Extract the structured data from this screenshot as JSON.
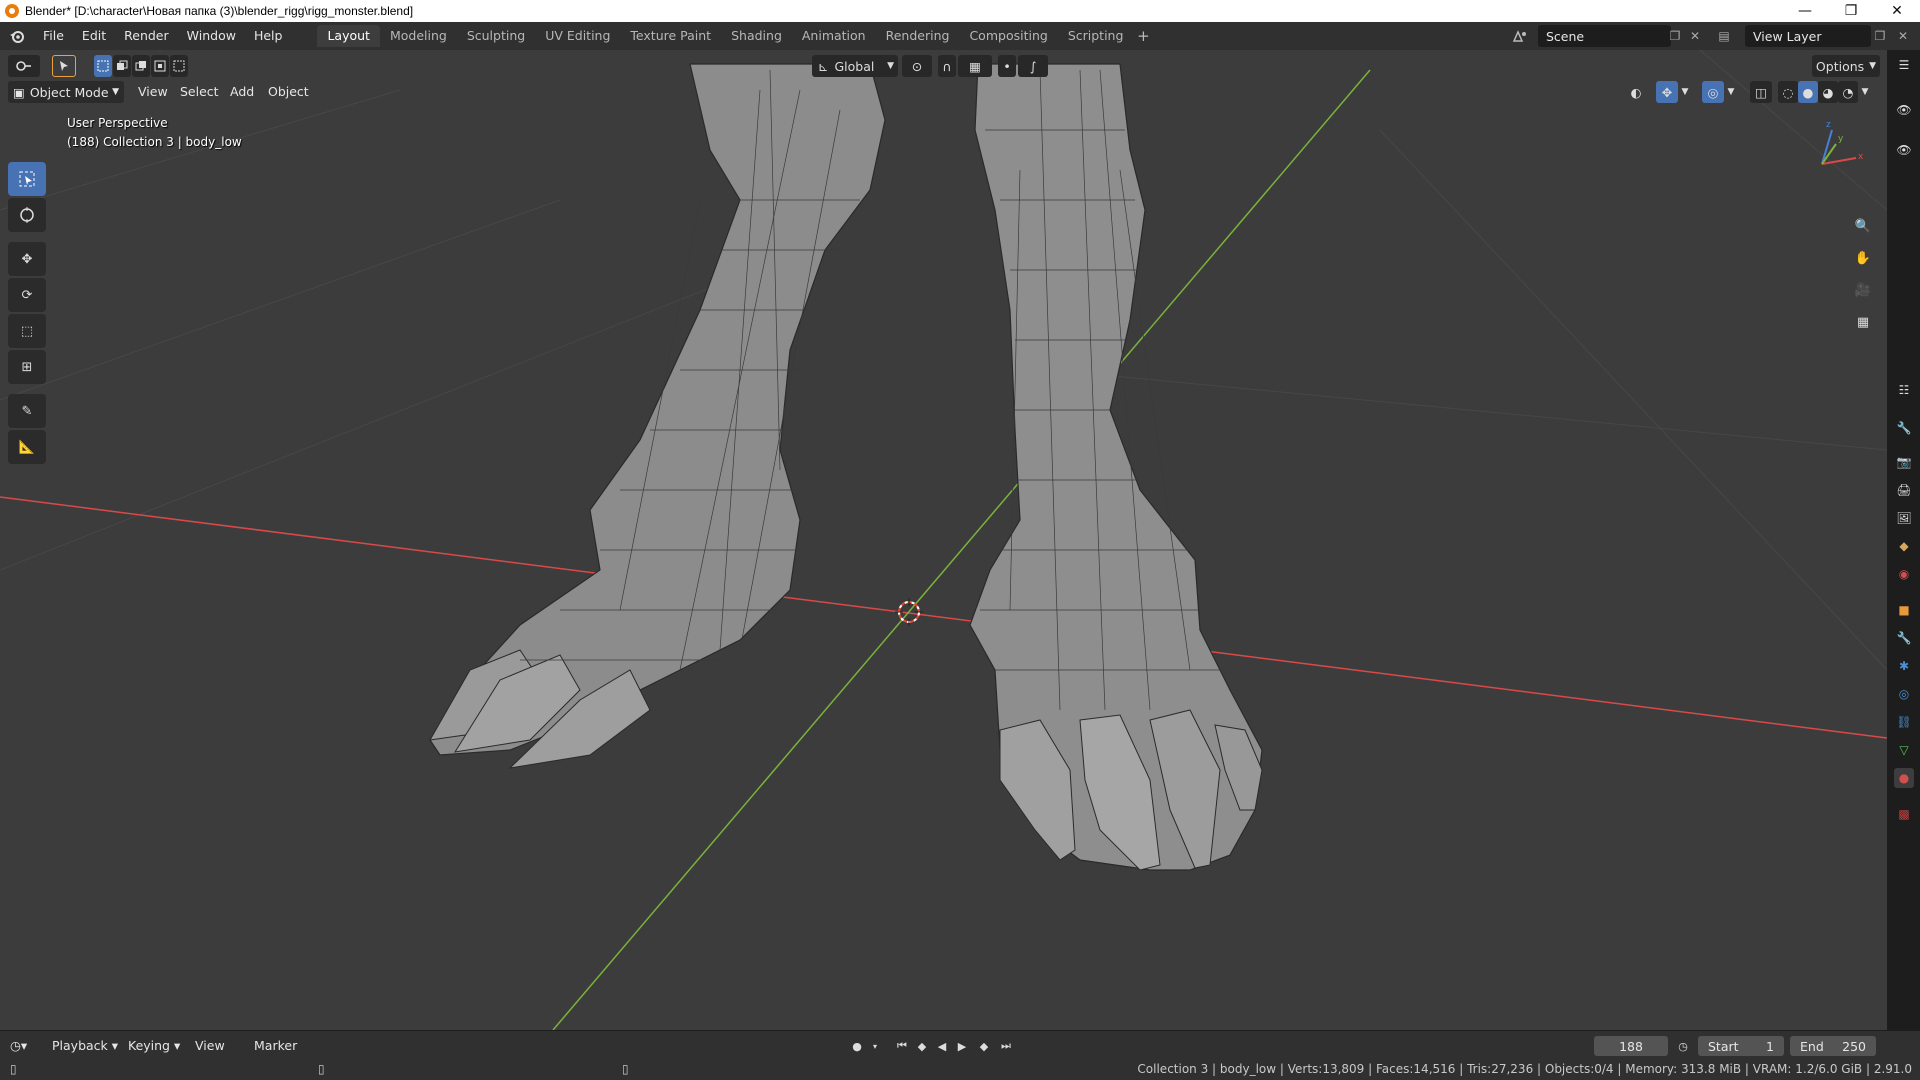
{
  "window": {
    "title": "Blender* [D:\\character\\Новая папка (3)\\blender_rigg\\rigg_monster.blend]",
    "controls": [
      "—",
      "❐",
      "✕"
    ]
  },
  "menus": [
    "File",
    "Edit",
    "Render",
    "Window",
    "Help"
  ],
  "workspaces": {
    "tabs": [
      "Layout",
      "Modeling",
      "Sculpting",
      "UV Editing",
      "Texture Paint",
      "Shading",
      "Animation",
      "Rendering",
      "Compositing",
      "Scripting"
    ],
    "active": "Layout",
    "add": "+"
  },
  "scene": {
    "name": "Scene"
  },
  "view_layer": {
    "name": "View Layer"
  },
  "viewport_header": {
    "mode": "Object Mode",
    "menus": [
      "View",
      "Select",
      "Add",
      "Object"
    ],
    "transform_orientation": "Global",
    "options": "Options"
  },
  "viewport_overlay": {
    "perspective": "User Perspective",
    "collection_info": "(188) Collection 3 | body_low"
  },
  "gizmo": {
    "x_label": "x",
    "y_label": "y",
    "z_label": "z"
  },
  "timeline": {
    "menus": [
      "Playback",
      "Keying",
      "View",
      "Marker"
    ],
    "current_frame": "188",
    "start_label": "Start",
    "start_value": "1",
    "end_label": "End",
    "end_value": "250"
  },
  "statusbar": {
    "text": "Collection 3 | body_low | Verts:13,809 | Faces:14,516 | Tris:27,236 | Objects:0/4 | Memory: 313.8 MiB | VRAM: 1.2/6.0 GiB | 2.91.0"
  },
  "colors": {
    "accent": "#4772b3",
    "x_axis": "#d84a4a",
    "y_axis": "#7ab33b",
    "z_axis": "#4a7fd8",
    "cursor": "#e8452c"
  }
}
